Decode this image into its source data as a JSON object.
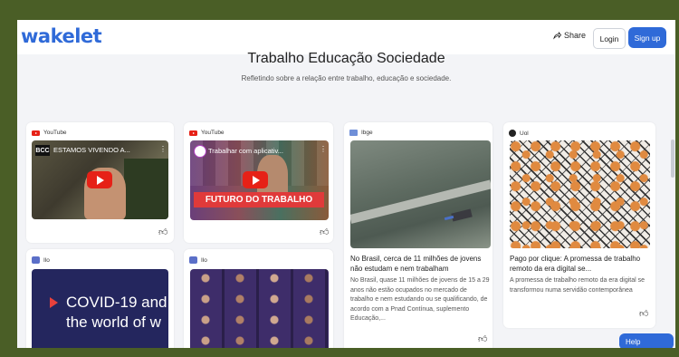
{
  "header": {
    "logo": "wakelet",
    "share_label": "Share",
    "login_label": "Login",
    "signup_label": "Sign up"
  },
  "page": {
    "title": "Trabalho Educação Sociedade",
    "subtitle": "Refletindo sobre a relação entre trabalho, educação e sociedade."
  },
  "cards": [
    {
      "source": "YouTube",
      "video_title": "ESTAMOS VIVENDO A...",
      "channel": "BCC"
    },
    {
      "source": "YouTube",
      "video_title": "Trabalhar com aplicativ...",
      "banner": "FUTURO DO TRABALHO"
    },
    {
      "source": "Ibge",
      "title": "No Brasil, cerca de 11 milhões de jovens não estudam e nem trabalham",
      "description": "No Brasil, quase 11 milhões de jovens de 15 a 29 anos não estão ocupados no mercado de trabalho e nem estudando ou se qualificando, de acordo com a Pnad Contínua, suplemento Educação,..."
    },
    {
      "source": "Uol",
      "title": "Pago por clique: A promessa de trabalho remoto da era digital se...",
      "description": "A promessa de trabalho remoto da era digital se transformou numa servidão contemporânea"
    },
    {
      "source": "Ilo",
      "image_text": "COVID-19 and the world of w"
    },
    {
      "source": "Ilo"
    }
  ],
  "help_label": "Help",
  "colors": {
    "brand": "#2f6ad8",
    "frame": "#4a5e26",
    "youtube": "#e62117"
  }
}
